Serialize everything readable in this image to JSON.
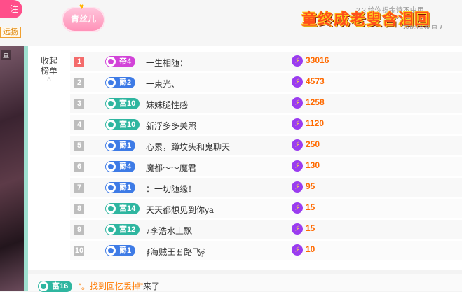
{
  "header": {
    "follow_label": "注",
    "yuanyang_label": "远扬",
    "fan_badge": "青丝儿",
    "marquee_big": "童终成老叟含泪回",
    "marquee_small_top": "2.3 给你祝金诗不由用",
    "marquee_small_bottom": "_ 花的哈选日人"
  },
  "video": {
    "tag": "直"
  },
  "panel": {
    "collapse_label": "收起榜单",
    "caret": "^"
  },
  "ranking": [
    {
      "rank": "1",
      "medal": "帝4",
      "level_class": "emperor",
      "name": "一生相随：",
      "score": "33016"
    },
    {
      "rank": "2",
      "medal": "爵2",
      "level_class": "duke",
      "name": "一束光、",
      "score": "4573"
    },
    {
      "rank": "3",
      "medal": "富10",
      "level_class": "rich",
      "name": "妹妹腿性感",
      "score": "1258"
    },
    {
      "rank": "4",
      "medal": "富10",
      "level_class": "rich",
      "name": "新浮多多关照",
      "score": "1120"
    },
    {
      "rank": "5",
      "medal": "爵1",
      "level_class": "duke",
      "name": "心累，蹲坟头和鬼聊天",
      "score": "250"
    },
    {
      "rank": "6",
      "medal": "爵4",
      "level_class": "duke",
      "name": "魔都～～魔君",
      "score": "130"
    },
    {
      "rank": "7",
      "medal": "爵1",
      "level_class": "duke",
      "name": "：一切随缘！",
      "score": "95"
    },
    {
      "rank": "8",
      "medal": "富14",
      "level_class": "rich",
      "name": "天天都想见到你ya",
      "score": "15"
    },
    {
      "rank": "9",
      "medal": "富12",
      "level_class": "rich",
      "name": "♪李浩水上飘",
      "score": "15"
    },
    {
      "rank": "10",
      "medal": "爵1",
      "level_class": "duke",
      "name": "∮海贼王￡路飞∮",
      "score": "10"
    }
  ],
  "enter": {
    "medal": "富16",
    "who": "“。找到回忆丢掉”",
    "action": "来了"
  },
  "colors": {
    "emperor": "#d243d8",
    "duke": "#3e7be6",
    "rich": "#2fb6a0",
    "score": "#ff6a00",
    "rank_top": "#f46b6b"
  },
  "icons": [
    "lightning-bolt-icon",
    "medal-icon",
    "chevron-up-icon",
    "heart-badge-icon"
  ]
}
